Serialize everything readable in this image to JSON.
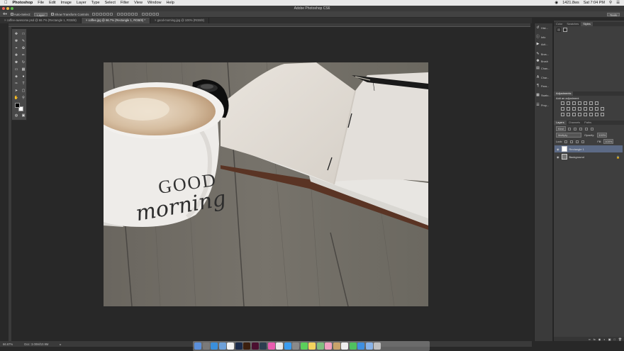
{
  "menubar": {
    "app_name": "Photoshop",
    "items": [
      "File",
      "Edit",
      "Image",
      "Layer",
      "Type",
      "Select",
      "Filter",
      "View",
      "Window",
      "Help"
    ],
    "battery": "1421.8ws",
    "clock": "Sat 7:04 PM"
  },
  "window": {
    "title": "Adobe Photoshop CS6"
  },
  "options_bar": {
    "auto_select_label": "Auto-Select:",
    "auto_select_value": "Layer",
    "transform_label": "Show Transform Controls",
    "workspace": "Tools"
  },
  "doc_tabs": [
    {
      "label": "coffee-awesome.psd @ 66.7% (Rectangle 1, RGB/8)",
      "active": false
    },
    {
      "label": "coffee.jpg @ 66.7% (Rectangle 1, RGB/8) *",
      "active": true
    },
    {
      "label": "good-morning.jpg @ 100% (RGB/8)",
      "active": false
    }
  ],
  "status_bar": {
    "zoom": "66.67%",
    "doc_size": "Doc: 3.00M/10.9M"
  },
  "right_strip": [
    {
      "icon": "history-icon",
      "label": "Hist..."
    },
    {
      "icon": "info-icon",
      "label": "Info"
    },
    {
      "icon": "actions-icon",
      "label": "Acti..."
    },
    {
      "icon": "brush-presets-icon",
      "label": "Brus..."
    },
    {
      "icon": "brush-icon",
      "label": "Brush"
    },
    {
      "icon": "channels-icon",
      "label": "Chan..."
    },
    {
      "icon": "character-icon",
      "label": "Char..."
    },
    {
      "icon": "paragraph-icon",
      "label": "Para..."
    },
    {
      "icon": "swatches-icon",
      "label": "Swatc..."
    },
    {
      "icon": "properties-icon",
      "label": "Prop..."
    }
  ],
  "color_panel": {
    "tabs": [
      "Color",
      "Swatches",
      "Styles"
    ],
    "active_tab": "Styles"
  },
  "adjustments_panel": {
    "title": "Adjustments",
    "subtitle": "Add an adjustment"
  },
  "layers_panel": {
    "tabs": [
      "Layers",
      "Channels",
      "Paths"
    ],
    "active_tab": "Layers",
    "kind_filter": "Kind",
    "blend_mode": "Multiply",
    "opacity_label": "Opacity:",
    "opacity_value": "100%",
    "lock_label": "Lock:",
    "fill_label": "Fill:",
    "fill_value": "100%",
    "layers": [
      {
        "name": "Rectangle 1",
        "selected": true
      },
      {
        "name": "Background",
        "selected": false
      }
    ]
  },
  "photo": {
    "mug_text_line1": "GOOD",
    "mug_text_line2": "morning"
  },
  "colors": {
    "foreground": "#000000",
    "background": "#ffffff",
    "selection": "#5c6a85"
  },
  "dock_apps": [
    "finder-icon",
    "launchpad-icon",
    "safari-icon",
    "mail-icon",
    "calendar-icon",
    "photoshop-icon",
    "illustrator-icon",
    "indesign-icon",
    "lightroom-icon",
    "itunes-icon",
    "chrome-icon",
    "app-store-icon",
    "preferences-icon",
    "messages-icon",
    "notes-icon",
    "maps-icon",
    "photos-icon",
    "contacts-icon",
    "reminders-icon",
    "facetime-icon",
    "downloads-icon",
    "folder-icon",
    "trash-icon"
  ]
}
